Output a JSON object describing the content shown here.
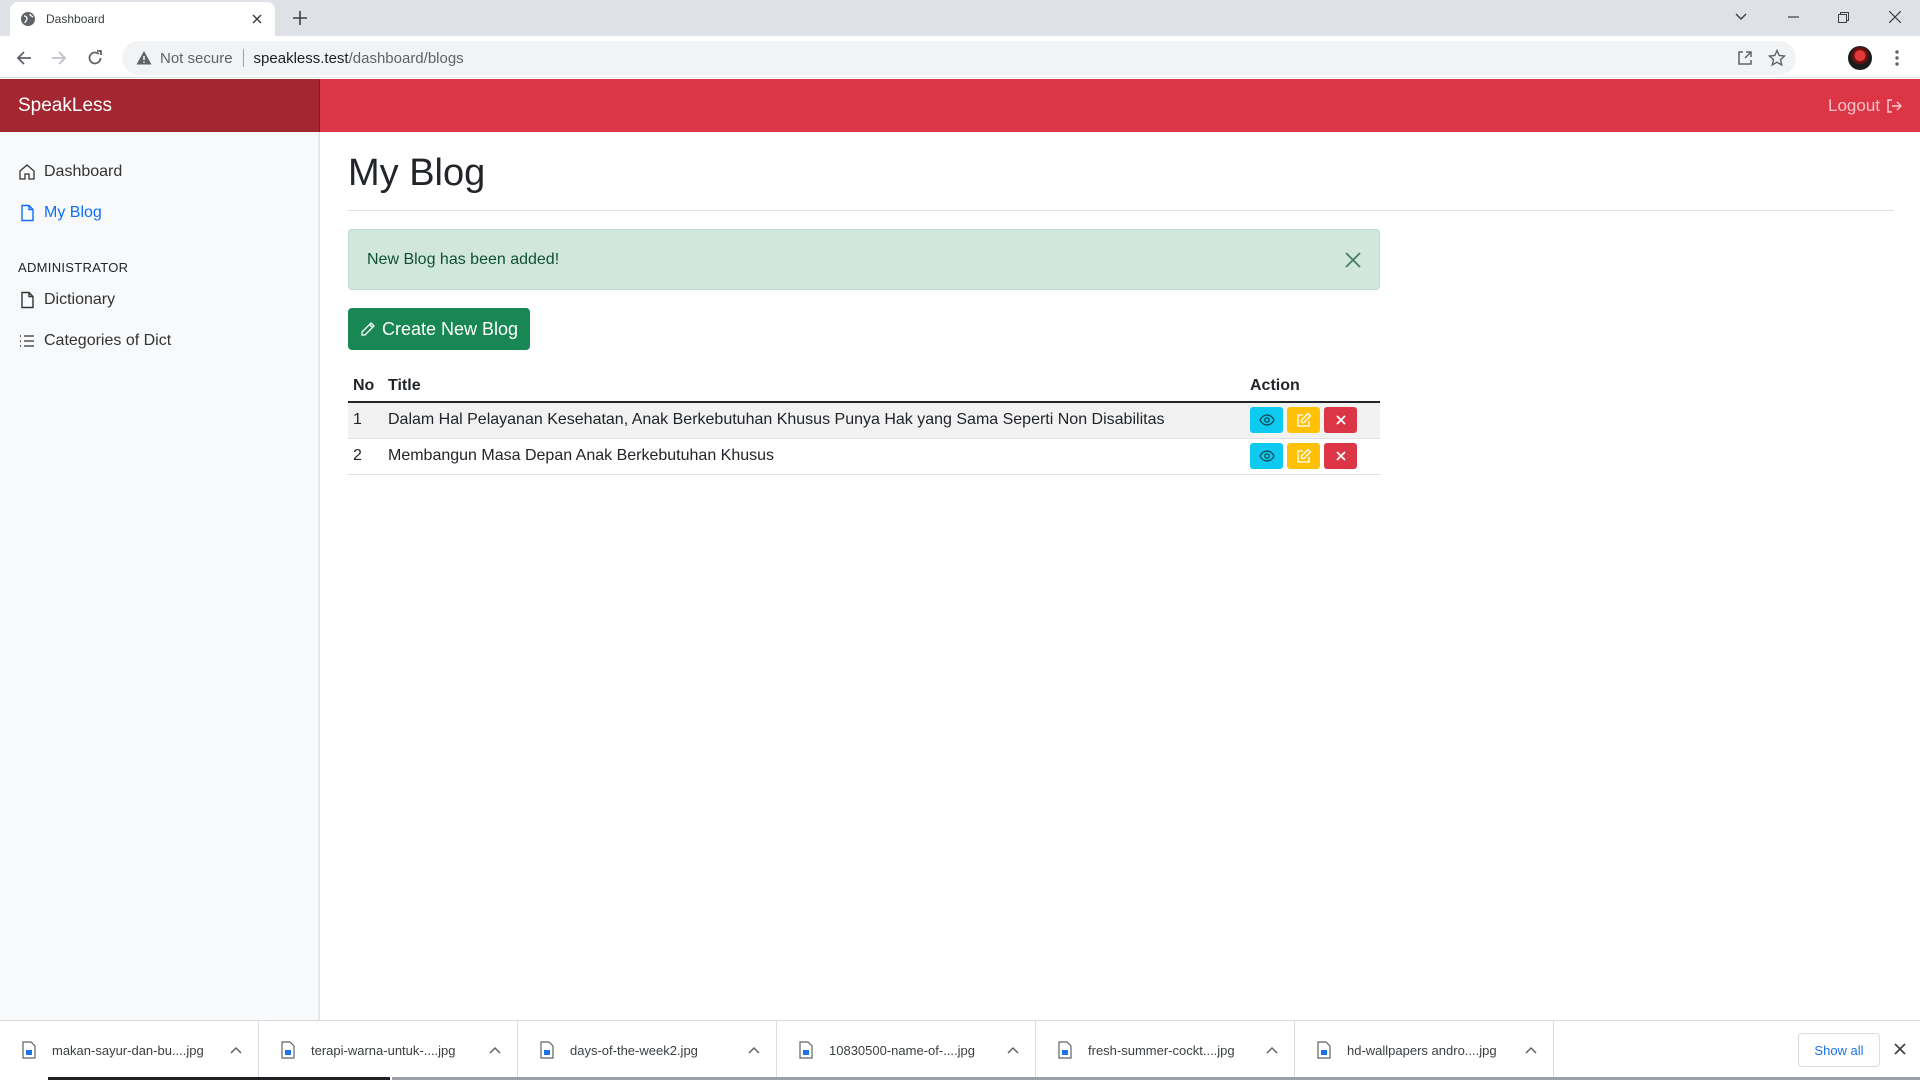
{
  "browser": {
    "tab_title": "Dashboard",
    "address": {
      "security_label": "Not secure",
      "host": "speakless.test",
      "path": "/dashboard/blogs"
    }
  },
  "header": {
    "brand": "SpeakLess",
    "logout_label": "Logout",
    "accent_color": "#dc3545"
  },
  "sidebar": {
    "items": [
      {
        "label": "Dashboard",
        "icon": "house-icon",
        "active": false
      },
      {
        "label": "My Blog",
        "icon": "file-icon",
        "active": true
      }
    ],
    "admin_heading": "ADMINISTRATOR",
    "admin_items": [
      {
        "label": "Dictionary",
        "icon": "file-icon"
      },
      {
        "label": "Categories of Dict",
        "icon": "list-icon"
      }
    ]
  },
  "main": {
    "title": "My Blog",
    "alert": "New Blog has been added!",
    "create_button": "Create New Blog",
    "table": {
      "headers": [
        "No",
        "Title",
        "Action"
      ],
      "rows": [
        {
          "no": "1",
          "title": "Dalam Hal Pelayanan Kesehatan, Anak Berkebutuhan Khusus Punya Hak yang Sama Seperti Non Disabilitas"
        },
        {
          "no": "2",
          "title": "Membangun Masa Depan Anak Berkebutuhan Khusus"
        }
      ]
    }
  },
  "downloads": {
    "items": [
      "makan-sayur-dan-bu....jpg",
      "terapi-warna-untuk-....jpg",
      "days-of-the-week2.jpg",
      "10830500-name-of-....jpg",
      "fresh-summer-cockt....jpg",
      "hd-wallpapers andro....jpg"
    ],
    "show_all": "Show all"
  }
}
